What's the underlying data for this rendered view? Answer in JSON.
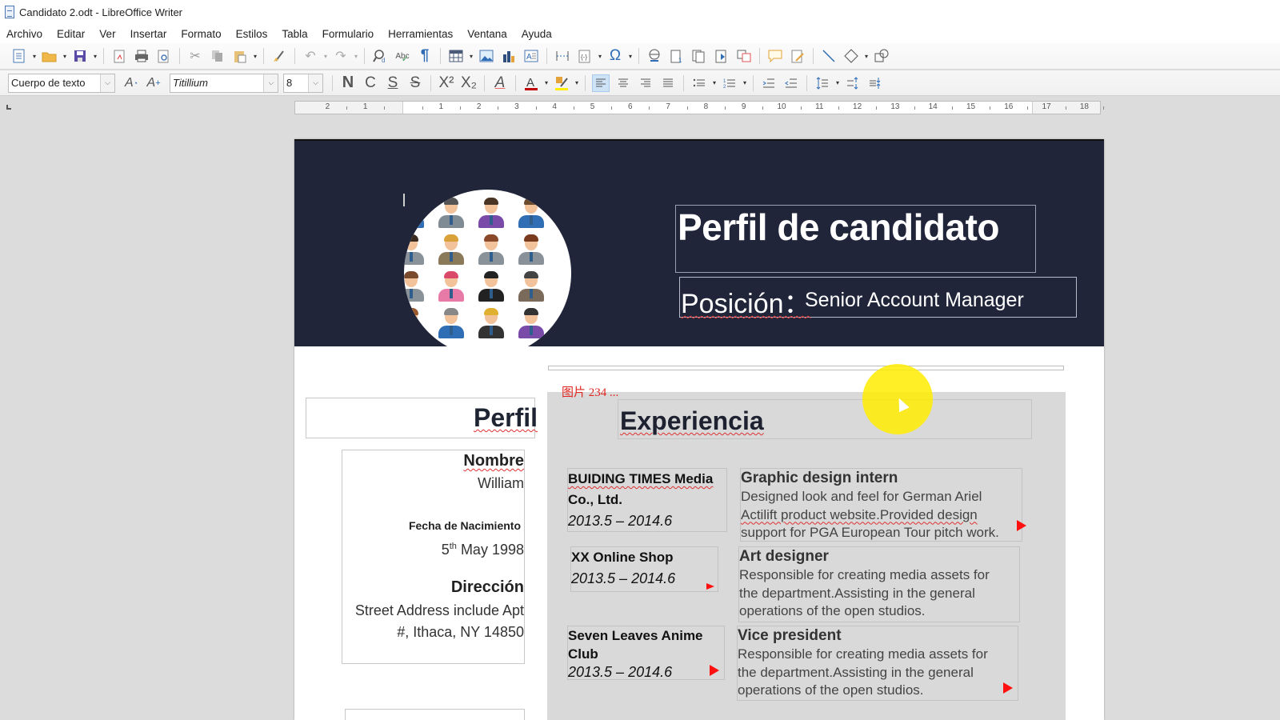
{
  "window": {
    "title": "Candidato 2.odt - LibreOffice Writer"
  },
  "menubar": {
    "items": [
      "Archivo",
      "Editar",
      "Ver",
      "Insertar",
      "Formato",
      "Estilos",
      "Tabla",
      "Formulario",
      "Herramientas",
      "Ventana",
      "Ayuda"
    ]
  },
  "toolbar_standard": {
    "icons": [
      "new-document-icon",
      "open-folder-icon",
      "save-icon",
      "export-pdf-icon",
      "print-icon",
      "print-preview-icon",
      "cut-icon",
      "copy-icon",
      "paste-icon",
      "clone-formatting-icon",
      "undo-icon",
      "redo-icon",
      "find-replace-icon",
      "spellcheck-icon",
      "formatting-marks-icon",
      "insert-table-icon",
      "insert-image-icon",
      "insert-chart-icon",
      "insert-textbox-icon",
      "page-break-icon",
      "insert-field-icon",
      "special-character-icon",
      "hyperlink-icon",
      "footnote-icon",
      "endnote-icon",
      "bookmark-icon",
      "cross-reference-icon",
      "comment-icon",
      "track-changes-icon",
      "line-icon",
      "basic-shapes-icon",
      "draw-functions-icon"
    ],
    "glyphs": {
      "special_character": "Ω",
      "formatting_marks": "¶"
    }
  },
  "toolbar_formatting": {
    "paragraph_style": "Cuerpo de texto",
    "font_name": "Titillium",
    "font_size": "8",
    "bold_label": "N",
    "italic_label": "C",
    "underline_label": "S",
    "strikethrough_label": "S",
    "superscript_label": "X²",
    "subscript_label": "X₂",
    "font_color": "#c00000",
    "highlight_color": "#ffee00",
    "active_alignment": "left"
  },
  "ruler": {
    "unit": "cm",
    "left_labels": [
      "2",
      "1"
    ],
    "labels": [
      "1",
      "2",
      "3",
      "4",
      "5",
      "6",
      "7",
      "8",
      "9",
      "10",
      "11",
      "12",
      "13",
      "14",
      "15",
      "16",
      "17",
      "18"
    ]
  },
  "document": {
    "header": {
      "background_color": "#21253a",
      "title": "Perfil de candidato",
      "position_label": "Posición：",
      "position_value": "Senior Account Manager"
    },
    "image_caption": "图片   234 ...",
    "profile": {
      "heading": "Perfil",
      "name_label": "Nombre",
      "name_value": "William",
      "birth_label": "Fecha de Nacimiento",
      "birth_day": "5",
      "birth_suffix": "th",
      "birth_rest": " May 1998",
      "address_label": "Dirección",
      "address_line1": "Street Address include Apt",
      "address_line2": "#, Ithaca, NY 14850"
    },
    "experience": {
      "heading": "Experiencia",
      "entries": [
        {
          "company_line1": "BUIDING TIMES Media",
          "company_line2": "Co., Ltd.",
          "dates": "2013.5 – 2014.6",
          "role": "Graphic design intern",
          "desc_line1": "Designed look and feel for German Ariel",
          "desc_line2": "Actilift product website.Provided design",
          "desc_line3": "support for PGA European Tour pitch work."
        },
        {
          "company_line1": "XX Online Shop",
          "company_line2": "",
          "dates": "2013.5 – 2014.6",
          "role": "Art designer",
          "desc_line1": "Responsible for creating media assets for",
          "desc_line2": "the department.Assisting in the general",
          "desc_line3": "operations of the open studios."
        },
        {
          "company_line1": "Seven Leaves Anime",
          "company_line2": "Club",
          "dates": "2013.5 – 2014.6",
          "role": "Vice president",
          "desc_line1": "Responsible for creating media assets for",
          "desc_line2": "the department.Assisting in the general",
          "desc_line3": "operations of the open studios."
        }
      ]
    }
  }
}
